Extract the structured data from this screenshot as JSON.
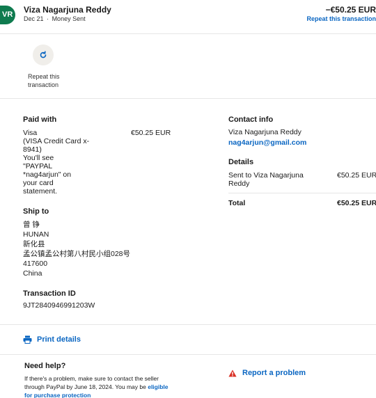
{
  "header": {
    "avatar_initials": "VR",
    "name": "Viza Nagarjuna Reddy",
    "date": "Dec 21",
    "separator": "·",
    "type": "Money Sent",
    "amount": "−€50.25 EUR",
    "repeat_link": "Repeat this transaction"
  },
  "repeat_action": {
    "label": "Repeat this transaction",
    "icon": "refresh-icon"
  },
  "paid_with": {
    "title": "Paid with",
    "method_lines": [
      "Visa",
      "(VISA Credit Card x-",
      "8941)",
      "You'll see",
      "\"PAYPAL",
      "*nag4arjun\" on",
      "your card",
      "statement."
    ],
    "amount": "€50.25 EUR"
  },
  "ship_to": {
    "title": "Ship to",
    "lines": [
      "曾 铮",
      "HUNAN",
      "新化县",
      "孟公镇孟公村第八村民小组028号",
      "417600",
      "China"
    ]
  },
  "transaction": {
    "title": "Transaction ID",
    "id": "9JT2840946991203W"
  },
  "contact_info": {
    "title": "Contact info",
    "name": "Viza Nagarjuna Reddy",
    "email": "nag4arjun@gmail.com"
  },
  "details": {
    "title": "Details",
    "sent_to_lines": [
      "Sent to Viza Nagarjuna",
      "Reddy"
    ],
    "sent_amount": "€50.25 EUR",
    "total_label": "Total",
    "total_amount": "€50.25 EUR"
  },
  "print": {
    "label": "Print details",
    "icon": "printer-icon"
  },
  "help": {
    "title": "Need help?",
    "text_lines": [
      "If there's a problem, make sure to contact the seller",
      "through PayPal by June 18, 2024. You may be "
    ],
    "link_part1": "eligible",
    "link_part2": "for purchase protection"
  },
  "report": {
    "label": "Report a problem",
    "icon": "warning-icon"
  },
  "colors": {
    "link": "#0a66c2",
    "avatar_bg": "#0f7b4f",
    "warning": "#d93025"
  }
}
